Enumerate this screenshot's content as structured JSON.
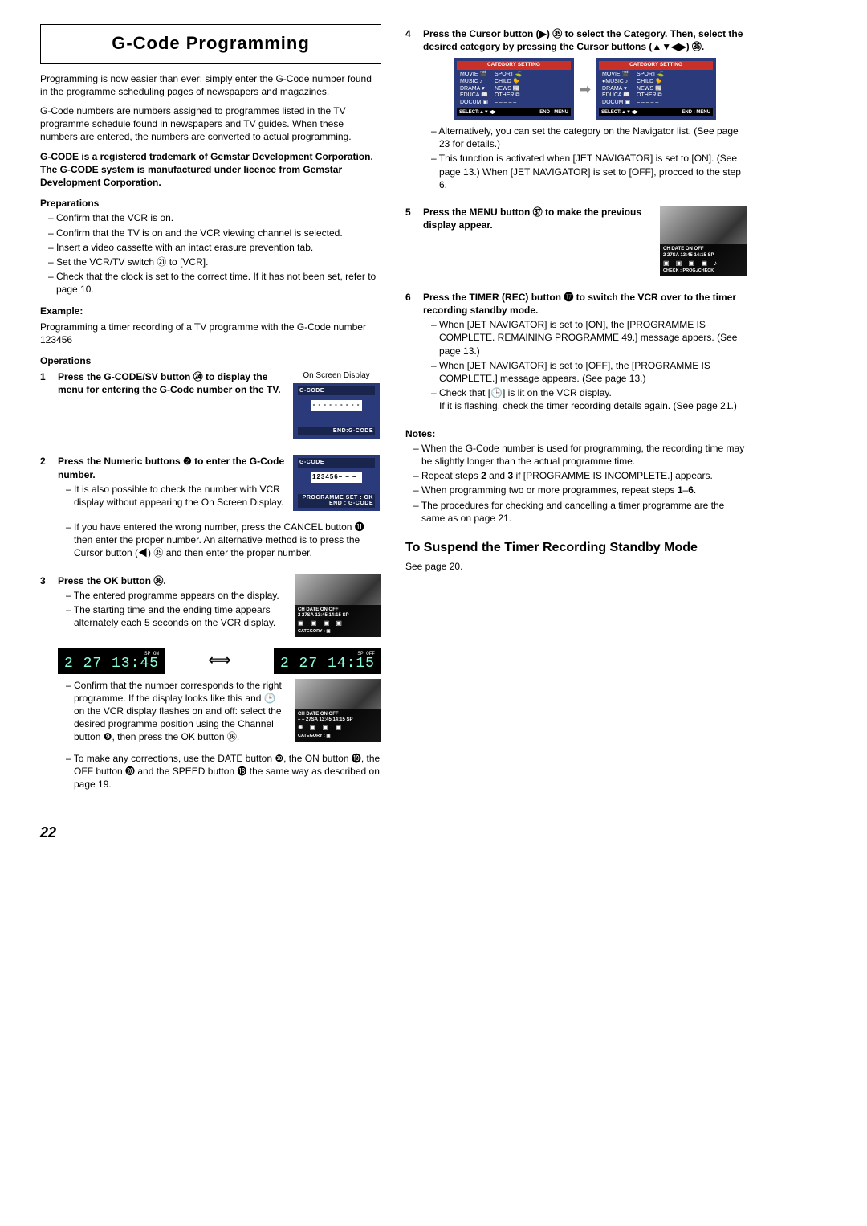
{
  "page_number": "22",
  "title": "G-Code  Programming",
  "intro1": "Programming is now easier than ever; simply enter the G-Code number found in the programme scheduling pages of newspapers and magazines.",
  "intro2": "G-Code numbers are numbers assigned to programmes listed in the TV programme schedule found in newspapers and TV guides. When these numbers are entered, the numbers are converted to actual programming.",
  "trademark": "G-CODE is a registered trademark of Gemstar Development Corporation. The G-CODE system is manufactured under licence from Gemstar Development Corporation.",
  "prep_head": "Preparations",
  "prep": [
    "Confirm that the VCR is on.",
    "Confirm that the TV is on and the VCR viewing channel is selected.",
    "Insert a video cassette with an intact erasure prevention tab.",
    "Set the VCR/TV switch ㉑ to [VCR].",
    "Check that the clock is set to the correct time. If it has not been set, refer to page 10."
  ],
  "example_head": "Example:",
  "example_body": "Programming a timer recording of a TV programme with the G-Code number 123456",
  "ops_head": "Operations",
  "osd_label": "On Screen Display",
  "osd1": {
    "bar": "G-CODE",
    "dashes": "- - - - - - - - -",
    "foot": "END:G-CODE"
  },
  "osd2": {
    "bar": "G-CODE",
    "num": "123456– – –",
    "foot1": "PROGRAMME SET : OK",
    "foot2": "END : G-CODE"
  },
  "step1": "Press the G-CODE/SV button ㉔ to display the menu for entering the G-Code number on the TV.",
  "step2_head": "Press the Numeric buttons ❷ to enter the G-Code number.",
  "step2_a": "It is also possible to check the number with VCR display without appearing the On Screen Display.",
  "step2_b": "If you have entered the wrong number, press the CANCEL button ⓫ then enter the proper number. An alternative method is to press the Cursor button (◀) ㉟ and then enter the proper number.",
  "step3_head": "Press the OK button ㊱.",
  "step3_a": "The entered programme appears on the display.",
  "step3_b": "The starting time and the ending time appears alternately each 5 seconds on the VCR display.",
  "step3_c": "Confirm that the number corresponds to the right programme. If the display looks like this and 🕒 on the VCR display flashes on and off: select the desired programme position using the Channel button ❾, then press the OK button ㊱.",
  "step3_d": "To make any corrections, use the DATE button ❿, the ON button ⓳, the OFF button ⓴ and the SPEED button ⓲ the same way as described on page 19.",
  "lcd_on": {
    "top": "SP   ON",
    "main": "2  27 13:45"
  },
  "lcd_off": {
    "top": "SP   OFF",
    "main": "2  27 14:15"
  },
  "thumb_cols": "CH  DATE   ON        OFF",
  "thumb_vals": " 2   27SA  13:45   14:15  SP",
  "thumb_vals2": " – –  27SA  13:45   14:15  SP",
  "thumb_cat": "CATEGORY : ▣",
  "step4": "Press the Cursor button (▶) ㉟ to select the Category. Then, select the desired category by pressing the Cursor buttons (▲▼◀▶) ㉟.",
  "cat_title": "CATEGORY SETTING",
  "cat_left": [
    "MOVIE  🎬",
    "MUSIC  ♪",
    "DRAMA  ♥",
    "EDUCA  📖",
    "DOCUM  ▣"
  ],
  "cat_right": [
    "SPORT  ⛳",
    "CHILD  🐤",
    "NEWS  📰",
    "OTHER  ⧉",
    "– – – – –"
  ],
  "cat_left_b": [
    "MOVIE  🎬",
    "●MUSIC  ♪",
    "DRAMA  ♥",
    "EDUCA  📖",
    "DOCUM  ▣"
  ],
  "cat_ftr_l": "SELECT:▲▼◀▶",
  "cat_ftr_r": "END : MENU",
  "step4_a": "Alternatively, you can set the category on the Navigator list. (See page 23 for details.)",
  "step4_b": "This function is activated when [JET NAVIGATOR] is set to [ON]. (See page 13.) When [JET NAVIGATOR] is set to [OFF], procced to the step 6.",
  "step5": "Press the MENU button ㊲ to make the previous display appear.",
  "thumb5_foot": "CHECK       : PROG./CHECK",
  "step6_head": "Press the TIMER (REC) button ⓱ to switch the VCR over to the timer recording standby mode.",
  "step6_a": "When [JET NAVIGATOR] is set to [ON], the [PROGRAMME IS COMPLETE. REMAINING PROGRAMME 49.] message appers. (See page 13.)",
  "step6_b": "When [JET NAVIGATOR] is set to [OFF], the [PROGRAMME IS COMPLETE.] message appears. (See page 13.)",
  "step6_c_1": "Check that [🕒] is lit on the VCR display.",
  "step6_c_2": "If it is flashing, check the timer recording details again. (See page 21.)",
  "notes_head": "Notes:",
  "notes": [
    "When the G-Code number is used for programming, the recording time may be slightly longer than the actual programme time.",
    "Repeat steps 2 and 3 if [PROGRAMME IS INCOMPLETE.] appears.",
    "When programming two or more programmes, repeat steps 1–6.",
    "The procedures for checking and cancelling a timer programme are the same as on page 21."
  ],
  "suspend_head": "To Suspend the Timer Recording Standby Mode",
  "suspend_body": "See page 20."
}
